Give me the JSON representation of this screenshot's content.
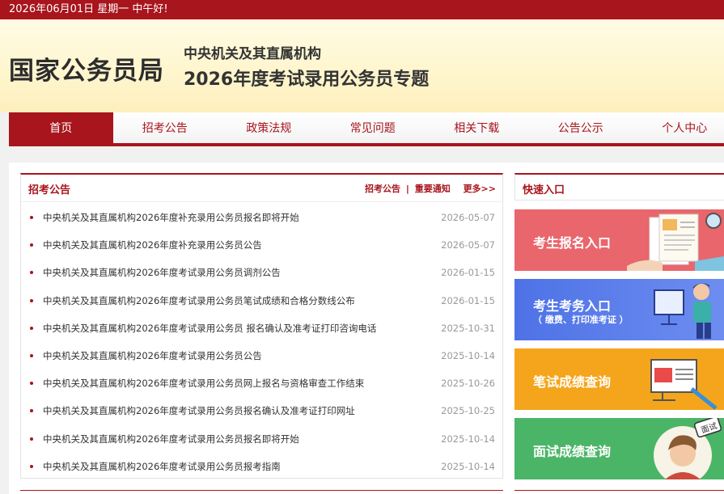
{
  "topbar": {
    "date_text": "2026年06月01日  星期一  中午好!"
  },
  "header": {
    "site_title": "国家公务员局",
    "subtitle_line1": "中央机关及其直属机构",
    "subtitle_line2": "2026年度考试录用公务员专题"
  },
  "nav": {
    "items": [
      {
        "label": "首页",
        "active": true
      },
      {
        "label": "招考公告"
      },
      {
        "label": "政策法规"
      },
      {
        "label": "常见问题"
      },
      {
        "label": "相关下载"
      },
      {
        "label": "公告公示"
      },
      {
        "label": "个人中心"
      }
    ]
  },
  "notices": {
    "title": "招考公告",
    "links": {
      "primary": "招考公告",
      "separator": "|",
      "secondary": "重要通知",
      "more": "更多>>"
    },
    "items": [
      {
        "title": "中央机关及其直属机构2026年度补充录用公务员报名即将开始",
        "date": "2026-05-07"
      },
      {
        "title": "中央机关及其直属机构2026年度补充录用公务员公告",
        "date": "2026-05-07"
      },
      {
        "title": "中央机关及其直属机构2026年度考试录用公务员调剂公告",
        "date": "2026-01-15"
      },
      {
        "title": "中央机关及其直属机构2026年度考试录用公务员笔试成绩和合格分数线公布",
        "date": "2026-01-15"
      },
      {
        "title": "中央机关及其直属机构2026年度考试录用公务员 报名确认及准考证打印咨询电话",
        "date": "2025-10-31"
      },
      {
        "title": "中央机关及其直属机构2026年度考试录用公务员公告",
        "date": "2025-10-14"
      },
      {
        "title": "中央机关及其直属机构2026年度考试录用公务员网上报名与资格审查工作结束",
        "date": "2025-10-26"
      },
      {
        "title": "中央机关及其直属机构2026年度考试录用公务员报名确认及准考证打印网址",
        "date": "2025-10-25"
      },
      {
        "title": "中央机关及其直属机构2026年度考试录用公务员报名即将开始",
        "date": "2025-10-14"
      },
      {
        "title": "中央机关及其直属机构2026年度考试录用公务员报考指南",
        "date": "2025-10-14"
      }
    ]
  },
  "quick": {
    "title": "快速入口",
    "buttons": [
      {
        "label": "考生报名入口",
        "icon": "registration-form-icon",
        "color": "#e9666c"
      },
      {
        "label": "考生考务入口",
        "sublabel": "（ 缴费、打印准考证 ）",
        "icon": "person-at-computer-icon",
        "color": "#5a7cea"
      },
      {
        "label": "笔试成绩查询",
        "icon": "exam-paper-icon",
        "color": "#f5a51c"
      },
      {
        "label": "面试成绩查询",
        "sublabel_badge": "面试",
        "icon": "interviewer-avatar-icon",
        "color": "#4bb567"
      }
    ]
  },
  "colors": {
    "brand_red": "#a8151c",
    "banner_bg": "#fff6cf"
  }
}
